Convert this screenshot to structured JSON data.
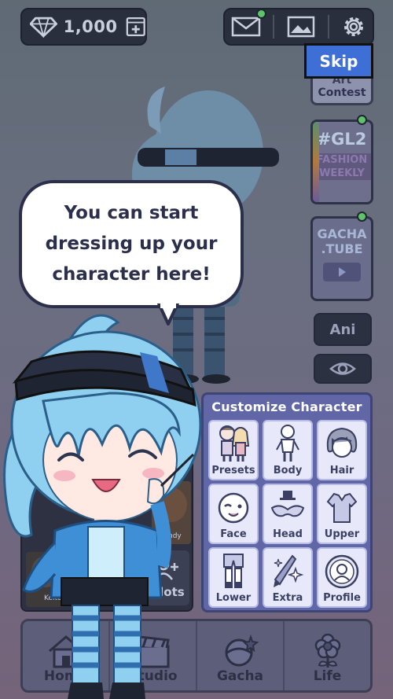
{
  "currency": {
    "gems": "1,000",
    "icon": "diamond-icon"
  },
  "toolbar": {
    "mail_icon": "mail-icon",
    "gallery_icon": "image-icon",
    "settings_icon": "gear-icon"
  },
  "skip_label": "Skip",
  "side_cards": {
    "art_contest": {
      "line1": "Art",
      "line2": "Contest"
    },
    "fashion_weekly": {
      "tag": "#GL2",
      "line1": "FASHION",
      "line2": "WEEKLY"
    },
    "gacha_tube": {
      "line1": "GACHA",
      "line2": ".TUBE"
    }
  },
  "ani_label": "Ani",
  "speech_bubble": "You can start\ndressing up your\ncharacter here!",
  "slots": {
    "names": [
      "ndy",
      "Keito"
    ],
    "slots_label": "Slots"
  },
  "customize": {
    "title": "Customize Character",
    "items": [
      "Presets",
      "Body",
      "Hair",
      "Face",
      "Head",
      "Upper",
      "Lower",
      "Extra",
      "Profile"
    ]
  },
  "nav": [
    "Home",
    "Studio",
    "Gacha",
    "Life"
  ],
  "colors": {
    "skip": "#3e6fd6",
    "panel": "#6066a6",
    "notification": "#5fc36b"
  }
}
